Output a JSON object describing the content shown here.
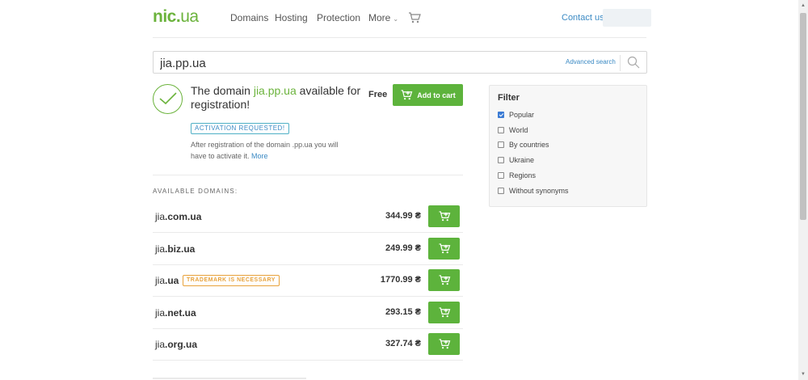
{
  "header": {
    "logo_main": "nic",
    "logo_dot": ".",
    "logo_tld": "ua",
    "nav": [
      "Domains",
      "Hosting",
      "Protection",
      "More"
    ],
    "contact": "Contact us"
  },
  "search": {
    "value": "jia.pp.ua",
    "advanced": "Advanced search"
  },
  "result": {
    "prefix": "The domain ",
    "domain": "jia.pp.ua",
    "suffix": " available for registration!",
    "price": "Free",
    "add_label": "Add to cart",
    "badge": "ACTIVATION REQUESTED!",
    "note": "After registration of the domain .pp.ua you will have to activate it. ",
    "more": "More"
  },
  "available": {
    "title": "AVAILABLE DOMAINS:",
    "rows": [
      {
        "name": "jia",
        "tld": ".com.ua",
        "price": "344.99 ₴",
        "badge": ""
      },
      {
        "name": "jia",
        "tld": ".biz.ua",
        "price": "249.99 ₴",
        "badge": ""
      },
      {
        "name": "jia",
        "tld": ".ua",
        "price": "1770.99 ₴",
        "badge": "TRADEMARK IS NECESSARY"
      },
      {
        "name": "jia",
        "tld": ".net.ua",
        "price": "293.15 ₴",
        "badge": ""
      },
      {
        "name": "jia",
        "tld": ".org.ua",
        "price": "327.74 ₴",
        "badge": ""
      }
    ]
  },
  "filter": {
    "title": "Filter",
    "items": [
      {
        "label": "Popular",
        "checked": true
      },
      {
        "label": "World",
        "checked": false
      },
      {
        "label": "By countries",
        "checked": false
      },
      {
        "label": "Ukraine",
        "checked": false
      },
      {
        "label": "Regions",
        "checked": false
      },
      {
        "label": "Without synonyms",
        "checked": false
      }
    ]
  },
  "colors": {
    "brand_green": "#6bb33c",
    "button_green": "#5db33c",
    "link_blue": "#3b8ac4",
    "warning_orange": "#e8a23b"
  },
  "icons": {
    "cart": "cart-icon",
    "search": "search-icon",
    "check": "check-icon"
  }
}
